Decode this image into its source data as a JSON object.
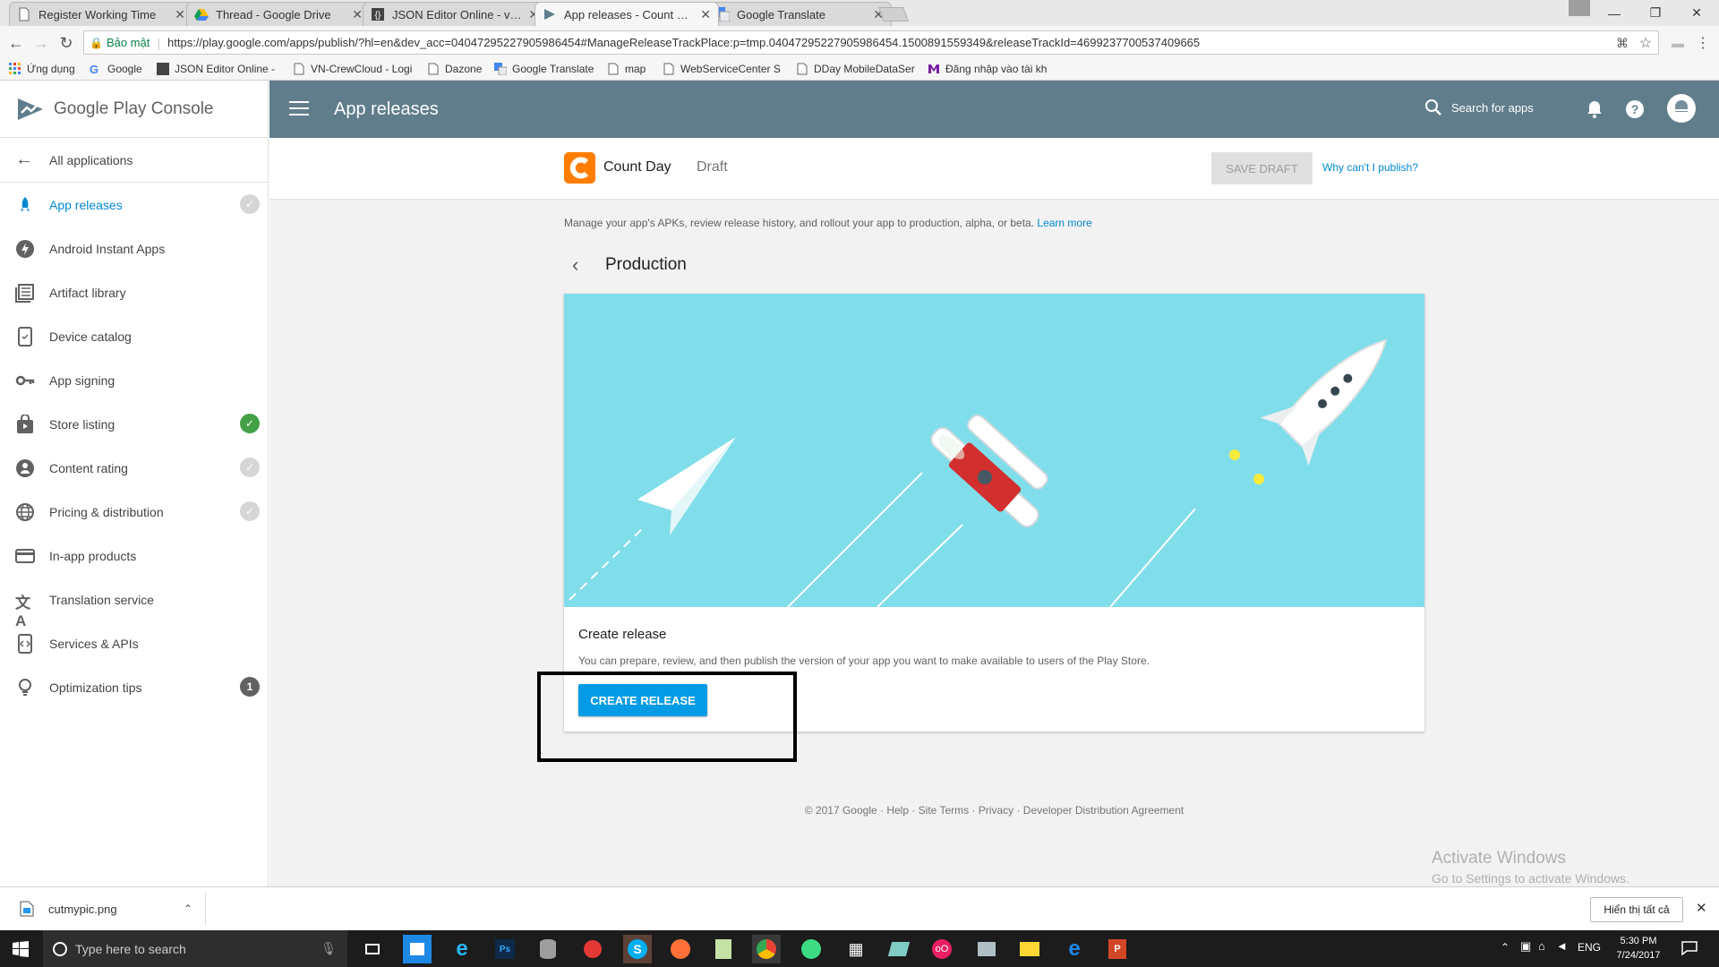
{
  "browser": {
    "tabs": [
      {
        "title": "Register Working Time",
        "icon": "document-icon"
      },
      {
        "title": "Thread - Google Drive",
        "icon": "drive-icon"
      },
      {
        "title": "JSON Editor Online - view",
        "icon": "json-editor-icon"
      },
      {
        "title": "App releases - Count Day",
        "icon": "play-console-icon",
        "active": true
      },
      {
        "title": "Google Translate",
        "icon": "translate-icon"
      }
    ],
    "secure_label": "Bảo mật",
    "url": "https://play.google.com/apps/publish/?hl=en&dev_acc=04047295227905986454#ManageReleaseTrackPlace:p=tmp.04047295227905986454.1500891559349&releaseTrackId=4699237700537409665",
    "bookmarks": [
      {
        "label": "Ứng dụng",
        "icon": "apps-grid-icon"
      },
      {
        "label": "Google",
        "icon": "google-icon"
      },
      {
        "label": "JSON Editor Online -",
        "icon": "json-editor-icon"
      },
      {
        "label": "VN-CrewCloud - Logi",
        "icon": "page-icon"
      },
      {
        "label": "Dazone",
        "icon": "page-icon"
      },
      {
        "label": "Google Translate",
        "icon": "translate-icon"
      },
      {
        "label": "map",
        "icon": "page-icon"
      },
      {
        "label": "WebServiceCenter S",
        "icon": "page-icon"
      },
      {
        "label": "DDay MobileDataSer",
        "icon": "page-icon"
      },
      {
        "label": "Đăng nhập vào tài kh",
        "icon": "login-icon"
      }
    ]
  },
  "console": {
    "brand": "Google Play Console",
    "page_title": "App releases",
    "search_placeholder": "Search for apps"
  },
  "sidebar": {
    "back_label": "All applications",
    "items": [
      {
        "label": "App releases",
        "icon": "rocket-icon",
        "status": "grey-check",
        "active": true
      },
      {
        "label": "Android Instant Apps",
        "icon": "bolt-icon",
        "status": ""
      },
      {
        "label": "Artifact library",
        "icon": "library-icon",
        "status": ""
      },
      {
        "label": "Device catalog",
        "icon": "device-icon",
        "status": ""
      },
      {
        "label": "App signing",
        "icon": "key-icon",
        "status": ""
      },
      {
        "label": "Store listing",
        "icon": "store-icon",
        "status": "green-check"
      },
      {
        "label": "Content rating",
        "icon": "rating-icon",
        "status": "grey-check"
      },
      {
        "label": "Pricing & distribution",
        "icon": "globe-icon",
        "status": "grey-check"
      },
      {
        "label": "In-app products",
        "icon": "card-icon",
        "status": ""
      },
      {
        "label": "Translation service",
        "icon": "translate-icon",
        "status": ""
      },
      {
        "label": "Services & APIs",
        "icon": "api-icon",
        "status": ""
      },
      {
        "label": "Optimization tips",
        "icon": "bulb-icon",
        "status": "count",
        "count": "1"
      }
    ]
  },
  "app": {
    "name": "Count Day",
    "state": "Draft",
    "save_draft": "SAVE DRAFT",
    "why_link": "Why can't I publish?"
  },
  "main": {
    "description": "Manage your app's APKs, review release history, and rollout your app to production, alpha, or beta.",
    "learn_more": "Learn more",
    "track_title": "Production",
    "card_title": "Create release",
    "card_text": "You can prepare, review, and then publish the version of your app you want to make available to users of the Play Store.",
    "create_button": "CREATE RELEASE",
    "footer": "© 2017 Google · Help · Site Terms · Privacy · Developer Distribution Agreement",
    "watermark_title": "Activate Windows",
    "watermark_sub": "Go to Settings to activate Windows."
  },
  "download": {
    "filename": "cutmypic.png",
    "show_all": "Hiển thị tất cả"
  },
  "taskbar": {
    "search_placeholder": "Type here to search",
    "lang": "ENG",
    "time": "5:30 PM",
    "date": "7/24/2017"
  },
  "colors": {
    "header": "#607d8b",
    "accent": "#039be5",
    "hero": "#80deea",
    "green_check": "#43a047",
    "logo_orange": "#ff7e00"
  }
}
